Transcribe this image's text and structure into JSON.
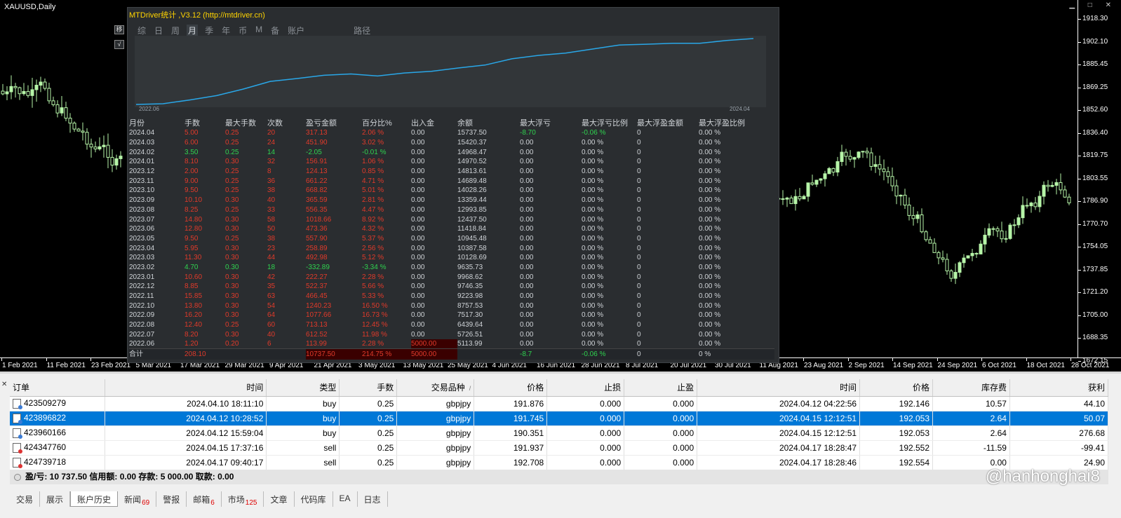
{
  "chart": {
    "symbol": "XAUUSD,Daily",
    "window_controls": "▁ □ ✕",
    "price_labels": [
      "1918.30",
      "1902.10",
      "1885.45",
      "1869.25",
      "1852.60",
      "1836.40",
      "1819.75",
      "1803.55",
      "1786.90",
      "1770.70",
      "1754.05",
      "1737.85",
      "1721.20",
      "1705.00",
      "1688.35",
      "1672.15"
    ],
    "time_labels": [
      "1 Feb 2021",
      "11 Feb 2021",
      "23 Feb 2021",
      "5 Mar 2021",
      "17 Mar 2021",
      "29 Mar 2021",
      "9 Apr 2021",
      "21 Apr 2021",
      "3 May 2021",
      "13 May 2021",
      "25 May 2021",
      "4 Jun 2021",
      "16 Jun 2021",
      "28 Jun 2021",
      "8 Jul 2021",
      "20 Jul 2021",
      "30 Jul 2021",
      "11 Aug 2021",
      "23 Aug 2021",
      "2 Sep 2021",
      "14 Sep 2021",
      "24 Sep 2021",
      "6 Oct 2021",
      "18 Oct 2021",
      "28 Oct 2021"
    ],
    "candle_color": "#b6f5a8"
  },
  "side_buttons": [
    "移",
    "√"
  ],
  "mtd": {
    "title": "MTDriver统计 ,V3.12 (http://mtdriver.cn)",
    "tabs": [
      "综",
      "日",
      "周",
      "月",
      "季",
      "年",
      "币",
      "M",
      "备",
      "账户"
    ],
    "active_tab": "月",
    "path_label": "路径",
    "graph_start": "2022.06",
    "graph_end": "2024.04",
    "line_color": "#29a7e8",
    "columns": [
      "月份",
      "手数",
      "最大手数",
      "次数",
      "盈亏金额",
      "百分比%",
      "出入金",
      "余额",
      "最大浮亏",
      "最大浮亏比例",
      "最大浮盈金额",
      "最大浮盈比例"
    ],
    "rows": [
      {
        "m": "2024.04",
        "lots": "5.00",
        "max": "0.25",
        "n": "20",
        "pl": "317.13",
        "pct": "2.06 %",
        "dep": "0.00",
        "bal": "15737.50",
        "fl": "-8.70",
        "flp": "-0.06 %",
        "fp": "0",
        "fpp": "0.00 %",
        "tone": "red"
      },
      {
        "m": "2024.03",
        "lots": "6.00",
        "max": "0.25",
        "n": "24",
        "pl": "451.90",
        "pct": "3.02 %",
        "dep": "0.00",
        "bal": "15420.37",
        "fl": "0.00",
        "flp": "0.00 %",
        "fp": "0",
        "fpp": "0.00 %",
        "tone": "red"
      },
      {
        "m": "2024.02",
        "lots": "3.50",
        "max": "0.25",
        "n": "14",
        "pl": "-2.05",
        "pct": "-0.01 %",
        "dep": "0.00",
        "bal": "14968.47",
        "fl": "0.00",
        "flp": "0.00 %",
        "fp": "0",
        "fpp": "0.00 %",
        "tone": "green"
      },
      {
        "m": "2024.01",
        "lots": "8.10",
        "max": "0.30",
        "n": "32",
        "pl": "156.91",
        "pct": "1.06 %",
        "dep": "0.00",
        "bal": "14970.52",
        "fl": "0.00",
        "flp": "0.00 %",
        "fp": "0",
        "fpp": "0.00 %",
        "tone": "red"
      },
      {
        "m": "2023.12",
        "lots": "2.00",
        "max": "0.25",
        "n": "8",
        "pl": "124.13",
        "pct": "0.85 %",
        "dep": "0.00",
        "bal": "14813.61",
        "fl": "0.00",
        "flp": "0.00 %",
        "fp": "0",
        "fpp": "0.00 %",
        "tone": "red"
      },
      {
        "m": "2023.11",
        "lots": "9.00",
        "max": "0.25",
        "n": "36",
        "pl": "661.22",
        "pct": "4.71 %",
        "dep": "0.00",
        "bal": "14689.48",
        "fl": "0.00",
        "flp": "0.00 %",
        "fp": "0",
        "fpp": "0.00 %",
        "tone": "red"
      },
      {
        "m": "2023.10",
        "lots": "9.50",
        "max": "0.25",
        "n": "38",
        "pl": "668.82",
        "pct": "5.01 %",
        "dep": "0.00",
        "bal": "14028.26",
        "fl": "0.00",
        "flp": "0.00 %",
        "fp": "0",
        "fpp": "0.00 %",
        "tone": "red"
      },
      {
        "m": "2023.09",
        "lots": "10.10",
        "max": "0.30",
        "n": "40",
        "pl": "365.59",
        "pct": "2.81 %",
        "dep": "0.00",
        "bal": "13359.44",
        "fl": "0.00",
        "flp": "0.00 %",
        "fp": "0",
        "fpp": "0.00 %",
        "tone": "red"
      },
      {
        "m": "2023.08",
        "lots": "8.25",
        "max": "0.25",
        "n": "33",
        "pl": "556.35",
        "pct": "4.47 %",
        "dep": "0.00",
        "bal": "12993.85",
        "fl": "0.00",
        "flp": "0.00 %",
        "fp": "0",
        "fpp": "0.00 %",
        "tone": "red"
      },
      {
        "m": "2023.07",
        "lots": "14.80",
        "max": "0.30",
        "n": "58",
        "pl": "1018.66",
        "pct": "8.92 %",
        "dep": "0.00",
        "bal": "12437.50",
        "fl": "0.00",
        "flp": "0.00 %",
        "fp": "0",
        "fpp": "0.00 %",
        "tone": "red"
      },
      {
        "m": "2023.06",
        "lots": "12.80",
        "max": "0.30",
        "n": "50",
        "pl": "473.36",
        "pct": "4.32 %",
        "dep": "0.00",
        "bal": "11418.84",
        "fl": "0.00",
        "flp": "0.00 %",
        "fp": "0",
        "fpp": "0.00 %",
        "tone": "red"
      },
      {
        "m": "2023.05",
        "lots": "9.50",
        "max": "0.25",
        "n": "38",
        "pl": "557.90",
        "pct": "5.37 %",
        "dep": "0.00",
        "bal": "10945.48",
        "fl": "0.00",
        "flp": "0.00 %",
        "fp": "0",
        "fpp": "0.00 %",
        "tone": "red"
      },
      {
        "m": "2023.04",
        "lots": "5.95",
        "max": "0.30",
        "n": "23",
        "pl": "258.89",
        "pct": "2.56 %",
        "dep": "0.00",
        "bal": "10387.58",
        "fl": "0.00",
        "flp": "0.00 %",
        "fp": "0",
        "fpp": "0.00 %",
        "tone": "red"
      },
      {
        "m": "2023.03",
        "lots": "11.30",
        "max": "0.30",
        "n": "44",
        "pl": "492.98",
        "pct": "5.12 %",
        "dep": "0.00",
        "bal": "10128.69",
        "fl": "0.00",
        "flp": "0.00 %",
        "fp": "0",
        "fpp": "0.00 %",
        "tone": "red"
      },
      {
        "m": "2023.02",
        "lots": "4.70",
        "max": "0.30",
        "n": "18",
        "pl": "-332.89",
        "pct": "-3.34 %",
        "dep": "0.00",
        "bal": "9635.73",
        "fl": "0.00",
        "flp": "0.00 %",
        "fp": "0",
        "fpp": "0.00 %",
        "tone": "green"
      },
      {
        "m": "2023.01",
        "lots": "10.60",
        "max": "0.30",
        "n": "42",
        "pl": "222.27",
        "pct": "2.28 %",
        "dep": "0.00",
        "bal": "9968.62",
        "fl": "0.00",
        "flp": "0.00 %",
        "fp": "0",
        "fpp": "0.00 %",
        "tone": "red"
      },
      {
        "m": "2022.12",
        "lots": "8.85",
        "max": "0.30",
        "n": "35",
        "pl": "522.37",
        "pct": "5.66 %",
        "dep": "0.00",
        "bal": "9746.35",
        "fl": "0.00",
        "flp": "0.00 %",
        "fp": "0",
        "fpp": "0.00 %",
        "tone": "red"
      },
      {
        "m": "2022.11",
        "lots": "15.85",
        "max": "0.30",
        "n": "63",
        "pl": "466.45",
        "pct": "5.33 %",
        "dep": "0.00",
        "bal": "9223.98",
        "fl": "0.00",
        "flp": "0.00 %",
        "fp": "0",
        "fpp": "0.00 %",
        "tone": "red"
      },
      {
        "m": "2022.10",
        "lots": "13.80",
        "max": "0.30",
        "n": "54",
        "pl": "1240.23",
        "pct": "16.50 %",
        "dep": "0.00",
        "bal": "8757.53",
        "fl": "0.00",
        "flp": "0.00 %",
        "fp": "0",
        "fpp": "0.00 %",
        "tone": "red"
      },
      {
        "m": "2022.09",
        "lots": "16.20",
        "max": "0.30",
        "n": "64",
        "pl": "1077.66",
        "pct": "16.73 %",
        "dep": "0.00",
        "bal": "7517.30",
        "fl": "0.00",
        "flp": "0.00 %",
        "fp": "0",
        "fpp": "0.00 %",
        "tone": "red"
      },
      {
        "m": "2022.08",
        "lots": "12.40",
        "max": "0.25",
        "n": "60",
        "pl": "713.13",
        "pct": "12.45 %",
        "dep": "0.00",
        "bal": "6439.64",
        "fl": "0.00",
        "flp": "0.00 %",
        "fp": "0",
        "fpp": "0.00 %",
        "tone": "red"
      },
      {
        "m": "2022.07",
        "lots": "8.20",
        "max": "0.30",
        "n": "40",
        "pl": "612.52",
        "pct": "11.98 %",
        "dep": "0.00",
        "bal": "5726.51",
        "fl": "0.00",
        "flp": "0.00 %",
        "fp": "0",
        "fpp": "0.00 %",
        "tone": "red"
      },
      {
        "m": "2022.06",
        "lots": "1.20",
        "max": "0.20",
        "n": "6",
        "pl": "113.99",
        "pct": "2.28 %",
        "dep": "5000.00",
        "bal": "5113.99",
        "fl": "0.00",
        "flp": "0.00 %",
        "fp": "0",
        "fpp": "0.00 %",
        "tone": "red"
      }
    ],
    "total": {
      "label": "合计",
      "lots": "208.10",
      "pl": "10737.50",
      "pct": "214.75 %",
      "dep": "5000.00",
      "fl": "-8.7",
      "flp": "-0.06 %",
      "fp": "0",
      "fpp": "0 %"
    }
  },
  "trades": {
    "columns": [
      "订单",
      "时间",
      "类型",
      "手数",
      "交易品种",
      "价格",
      "止损",
      "止盈",
      "时间",
      "价格",
      "库存费",
      "获利"
    ],
    "sort_glyph": "/",
    "rows": [
      {
        "ticket": "423509279",
        "open": "2024.04.10 18:11:10",
        "type": "buy",
        "lots": "0.25",
        "sym": "gbpjpy",
        "price": "191.876",
        "sl": "0.000",
        "tp": "0.000",
        "close": "2024.04.12 04:22:56",
        "cprice": "192.146",
        "swap": "10.57",
        "profit": "44.10",
        "selected": false
      },
      {
        "ticket": "423896822",
        "open": "2024.04.12 10:28:52",
        "type": "buy",
        "lots": "0.25",
        "sym": "gbpjpy",
        "price": "191.745",
        "sl": "0.000",
        "tp": "0.000",
        "close": "2024.04.15 12:12:51",
        "cprice": "192.053",
        "swap": "2.64",
        "profit": "50.07",
        "selected": true
      },
      {
        "ticket": "423960166",
        "open": "2024.04.12 15:59:04",
        "type": "buy",
        "lots": "0.25",
        "sym": "gbpjpy",
        "price": "190.351",
        "sl": "0.000",
        "tp": "0.000",
        "close": "2024.04.15 12:12:51",
        "cprice": "192.053",
        "swap": "2.64",
        "profit": "276.68",
        "selected": false
      },
      {
        "ticket": "424347760",
        "open": "2024.04.15 17:37:16",
        "type": "sell",
        "lots": "0.25",
        "sym": "gbpjpy",
        "price": "191.937",
        "sl": "0.000",
        "tp": "0.000",
        "close": "2024.04.17 18:28:47",
        "cprice": "192.552",
        "swap": "-11.59",
        "profit": "-99.41",
        "selected": false
      },
      {
        "ticket": "424739718",
        "open": "2024.04.17 09:40:17",
        "type": "sell",
        "lots": "0.25",
        "sym": "gbpjpy",
        "price": "192.708",
        "sl": "0.000",
        "tp": "0.000",
        "close": "2024.04.17 18:28:46",
        "cprice": "192.554",
        "swap": "0.00",
        "profit": "24.90",
        "selected": false
      }
    ],
    "summary": "盈/亏: 10 737.50  信用额: 0.00  存款: 5 000.00  取款: 0.00"
  },
  "terminal_tabs": [
    {
      "label": "交易",
      "count": ""
    },
    {
      "label": "展示",
      "count": ""
    },
    {
      "label": "账户历史",
      "count": "",
      "active": true
    },
    {
      "label": "新闻",
      "count": "69"
    },
    {
      "label": "警报",
      "count": ""
    },
    {
      "label": "邮箱",
      "count": "6"
    },
    {
      "label": "市场",
      "count": "125"
    },
    {
      "label": "文章",
      "count": ""
    },
    {
      "label": "代码库",
      "count": ""
    },
    {
      "label": "EA",
      "count": ""
    },
    {
      "label": "日志",
      "count": ""
    }
  ],
  "terminal_close": "✕",
  "watermark": "@hanhonghai8"
}
